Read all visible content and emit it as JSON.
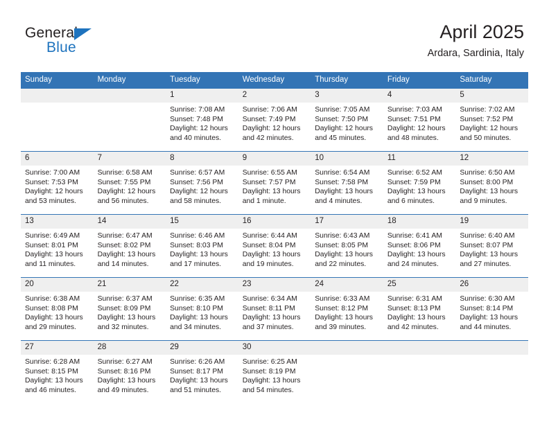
{
  "brand": {
    "name_dark": "General",
    "name_light": "Blue",
    "accent_color": "#1e73be"
  },
  "header": {
    "title": "April 2025",
    "subtitle": "Ardara, Sardinia, Italy",
    "header_bg_color": "#3374b5",
    "daynum_bg_color": "#efefef"
  },
  "weekdays": [
    "Sunday",
    "Monday",
    "Tuesday",
    "Wednesday",
    "Thursday",
    "Friday",
    "Saturday"
  ],
  "weeks": [
    [
      {
        "day": "",
        "sunrise": "",
        "sunset": "",
        "daylight1": "",
        "daylight2": ""
      },
      {
        "day": "",
        "sunrise": "",
        "sunset": "",
        "daylight1": "",
        "daylight2": ""
      },
      {
        "day": "1",
        "sunrise": "Sunrise: 7:08 AM",
        "sunset": "Sunset: 7:48 PM",
        "daylight1": "Daylight: 12 hours",
        "daylight2": "and 40 minutes."
      },
      {
        "day": "2",
        "sunrise": "Sunrise: 7:06 AM",
        "sunset": "Sunset: 7:49 PM",
        "daylight1": "Daylight: 12 hours",
        "daylight2": "and 42 minutes."
      },
      {
        "day": "3",
        "sunrise": "Sunrise: 7:05 AM",
        "sunset": "Sunset: 7:50 PM",
        "daylight1": "Daylight: 12 hours",
        "daylight2": "and 45 minutes."
      },
      {
        "day": "4",
        "sunrise": "Sunrise: 7:03 AM",
        "sunset": "Sunset: 7:51 PM",
        "daylight1": "Daylight: 12 hours",
        "daylight2": "and 48 minutes."
      },
      {
        "day": "5",
        "sunrise": "Sunrise: 7:02 AM",
        "sunset": "Sunset: 7:52 PM",
        "daylight1": "Daylight: 12 hours",
        "daylight2": "and 50 minutes."
      }
    ],
    [
      {
        "day": "6",
        "sunrise": "Sunrise: 7:00 AM",
        "sunset": "Sunset: 7:53 PM",
        "daylight1": "Daylight: 12 hours",
        "daylight2": "and 53 minutes."
      },
      {
        "day": "7",
        "sunrise": "Sunrise: 6:58 AM",
        "sunset": "Sunset: 7:55 PM",
        "daylight1": "Daylight: 12 hours",
        "daylight2": "and 56 minutes."
      },
      {
        "day": "8",
        "sunrise": "Sunrise: 6:57 AM",
        "sunset": "Sunset: 7:56 PM",
        "daylight1": "Daylight: 12 hours",
        "daylight2": "and 58 minutes."
      },
      {
        "day": "9",
        "sunrise": "Sunrise: 6:55 AM",
        "sunset": "Sunset: 7:57 PM",
        "daylight1": "Daylight: 13 hours",
        "daylight2": "and 1 minute."
      },
      {
        "day": "10",
        "sunrise": "Sunrise: 6:54 AM",
        "sunset": "Sunset: 7:58 PM",
        "daylight1": "Daylight: 13 hours",
        "daylight2": "and 4 minutes."
      },
      {
        "day": "11",
        "sunrise": "Sunrise: 6:52 AM",
        "sunset": "Sunset: 7:59 PM",
        "daylight1": "Daylight: 13 hours",
        "daylight2": "and 6 minutes."
      },
      {
        "day": "12",
        "sunrise": "Sunrise: 6:50 AM",
        "sunset": "Sunset: 8:00 PM",
        "daylight1": "Daylight: 13 hours",
        "daylight2": "and 9 minutes."
      }
    ],
    [
      {
        "day": "13",
        "sunrise": "Sunrise: 6:49 AM",
        "sunset": "Sunset: 8:01 PM",
        "daylight1": "Daylight: 13 hours",
        "daylight2": "and 11 minutes."
      },
      {
        "day": "14",
        "sunrise": "Sunrise: 6:47 AM",
        "sunset": "Sunset: 8:02 PM",
        "daylight1": "Daylight: 13 hours",
        "daylight2": "and 14 minutes."
      },
      {
        "day": "15",
        "sunrise": "Sunrise: 6:46 AM",
        "sunset": "Sunset: 8:03 PM",
        "daylight1": "Daylight: 13 hours",
        "daylight2": "and 17 minutes."
      },
      {
        "day": "16",
        "sunrise": "Sunrise: 6:44 AM",
        "sunset": "Sunset: 8:04 PM",
        "daylight1": "Daylight: 13 hours",
        "daylight2": "and 19 minutes."
      },
      {
        "day": "17",
        "sunrise": "Sunrise: 6:43 AM",
        "sunset": "Sunset: 8:05 PM",
        "daylight1": "Daylight: 13 hours",
        "daylight2": "and 22 minutes."
      },
      {
        "day": "18",
        "sunrise": "Sunrise: 6:41 AM",
        "sunset": "Sunset: 8:06 PM",
        "daylight1": "Daylight: 13 hours",
        "daylight2": "and 24 minutes."
      },
      {
        "day": "19",
        "sunrise": "Sunrise: 6:40 AM",
        "sunset": "Sunset: 8:07 PM",
        "daylight1": "Daylight: 13 hours",
        "daylight2": "and 27 minutes."
      }
    ],
    [
      {
        "day": "20",
        "sunrise": "Sunrise: 6:38 AM",
        "sunset": "Sunset: 8:08 PM",
        "daylight1": "Daylight: 13 hours",
        "daylight2": "and 29 minutes."
      },
      {
        "day": "21",
        "sunrise": "Sunrise: 6:37 AM",
        "sunset": "Sunset: 8:09 PM",
        "daylight1": "Daylight: 13 hours",
        "daylight2": "and 32 minutes."
      },
      {
        "day": "22",
        "sunrise": "Sunrise: 6:35 AM",
        "sunset": "Sunset: 8:10 PM",
        "daylight1": "Daylight: 13 hours",
        "daylight2": "and 34 minutes."
      },
      {
        "day": "23",
        "sunrise": "Sunrise: 6:34 AM",
        "sunset": "Sunset: 8:11 PM",
        "daylight1": "Daylight: 13 hours",
        "daylight2": "and 37 minutes."
      },
      {
        "day": "24",
        "sunrise": "Sunrise: 6:33 AM",
        "sunset": "Sunset: 8:12 PM",
        "daylight1": "Daylight: 13 hours",
        "daylight2": "and 39 minutes."
      },
      {
        "day": "25",
        "sunrise": "Sunrise: 6:31 AM",
        "sunset": "Sunset: 8:13 PM",
        "daylight1": "Daylight: 13 hours",
        "daylight2": "and 42 minutes."
      },
      {
        "day": "26",
        "sunrise": "Sunrise: 6:30 AM",
        "sunset": "Sunset: 8:14 PM",
        "daylight1": "Daylight: 13 hours",
        "daylight2": "and 44 minutes."
      }
    ],
    [
      {
        "day": "27",
        "sunrise": "Sunrise: 6:28 AM",
        "sunset": "Sunset: 8:15 PM",
        "daylight1": "Daylight: 13 hours",
        "daylight2": "and 46 minutes."
      },
      {
        "day": "28",
        "sunrise": "Sunrise: 6:27 AM",
        "sunset": "Sunset: 8:16 PM",
        "daylight1": "Daylight: 13 hours",
        "daylight2": "and 49 minutes."
      },
      {
        "day": "29",
        "sunrise": "Sunrise: 6:26 AM",
        "sunset": "Sunset: 8:17 PM",
        "daylight1": "Daylight: 13 hours",
        "daylight2": "and 51 minutes."
      },
      {
        "day": "30",
        "sunrise": "Sunrise: 6:25 AM",
        "sunset": "Sunset: 8:19 PM",
        "daylight1": "Daylight: 13 hours",
        "daylight2": "and 54 minutes."
      },
      {
        "day": "",
        "sunrise": "",
        "sunset": "",
        "daylight1": "",
        "daylight2": ""
      },
      {
        "day": "",
        "sunrise": "",
        "sunset": "",
        "daylight1": "",
        "daylight2": ""
      },
      {
        "day": "",
        "sunrise": "",
        "sunset": "",
        "daylight1": "",
        "daylight2": ""
      }
    ]
  ]
}
